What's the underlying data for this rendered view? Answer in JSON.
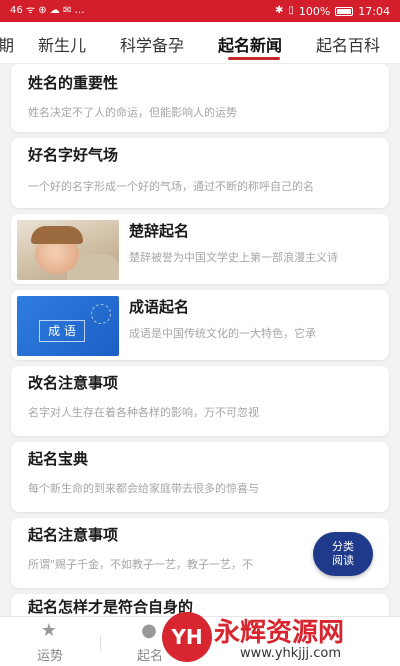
{
  "status_bar": {
    "left_indicators": "46 ᯤ ⊕ ☁ ✉ …",
    "right_text": "100%",
    "time": "17:04"
  },
  "tabs": [
    {
      "label": "期",
      "active": false
    },
    {
      "label": "新生儿",
      "active": false
    },
    {
      "label": "科学备孕",
      "active": false
    },
    {
      "label": "起名新闻",
      "active": true
    },
    {
      "label": "起名百科",
      "active": false
    }
  ],
  "articles": [
    {
      "title": "姓名的重要性",
      "desc": "姓名决定不了人的命运，但能影响人的运势",
      "image": null
    },
    {
      "title": "好名字好气场",
      "desc": "一个好的名字形成一个好的气场，通过不断的称呼自己的名",
      "image": null
    },
    {
      "title": "楚辞起名",
      "desc": "楚辞被誉为中国文学史上第一部浪漫主义诗",
      "image": "baby-photo"
    },
    {
      "title": "成语起名",
      "desc": "成语是中国传统文化的一大特色，它承",
      "image": "idiom",
      "image_text": "成 语"
    },
    {
      "title": "改名注意事项",
      "desc": "名字对人生存在着各种各样的影响，万不可忽视",
      "image": null
    },
    {
      "title": "起名宝典",
      "desc": "每个新生命的到来都会给家庭带去很多的惊喜与",
      "image": null
    },
    {
      "title": "起名注意事项",
      "desc": "所谓\"赐子千金，不如教子一艺，教子一艺，不",
      "image": null
    },
    {
      "title": "起名怎样才是符合自身的",
      "desc": "",
      "image": null
    }
  ],
  "fab": {
    "line1": "分类",
    "line2": "阅读"
  },
  "bottom_nav": [
    {
      "label": "运势",
      "icon": "star-icon"
    },
    {
      "label": "起名",
      "icon": "chat-icon"
    }
  ],
  "watermark": {
    "logo": "YH",
    "title": "永辉资源网",
    "url": "www.yhkjjj.com"
  },
  "colors": {
    "status_bar": "#d21f2b",
    "tab_underline": "#c62828",
    "fab": "#1f3a8a",
    "watermark": "#d7262f"
  }
}
